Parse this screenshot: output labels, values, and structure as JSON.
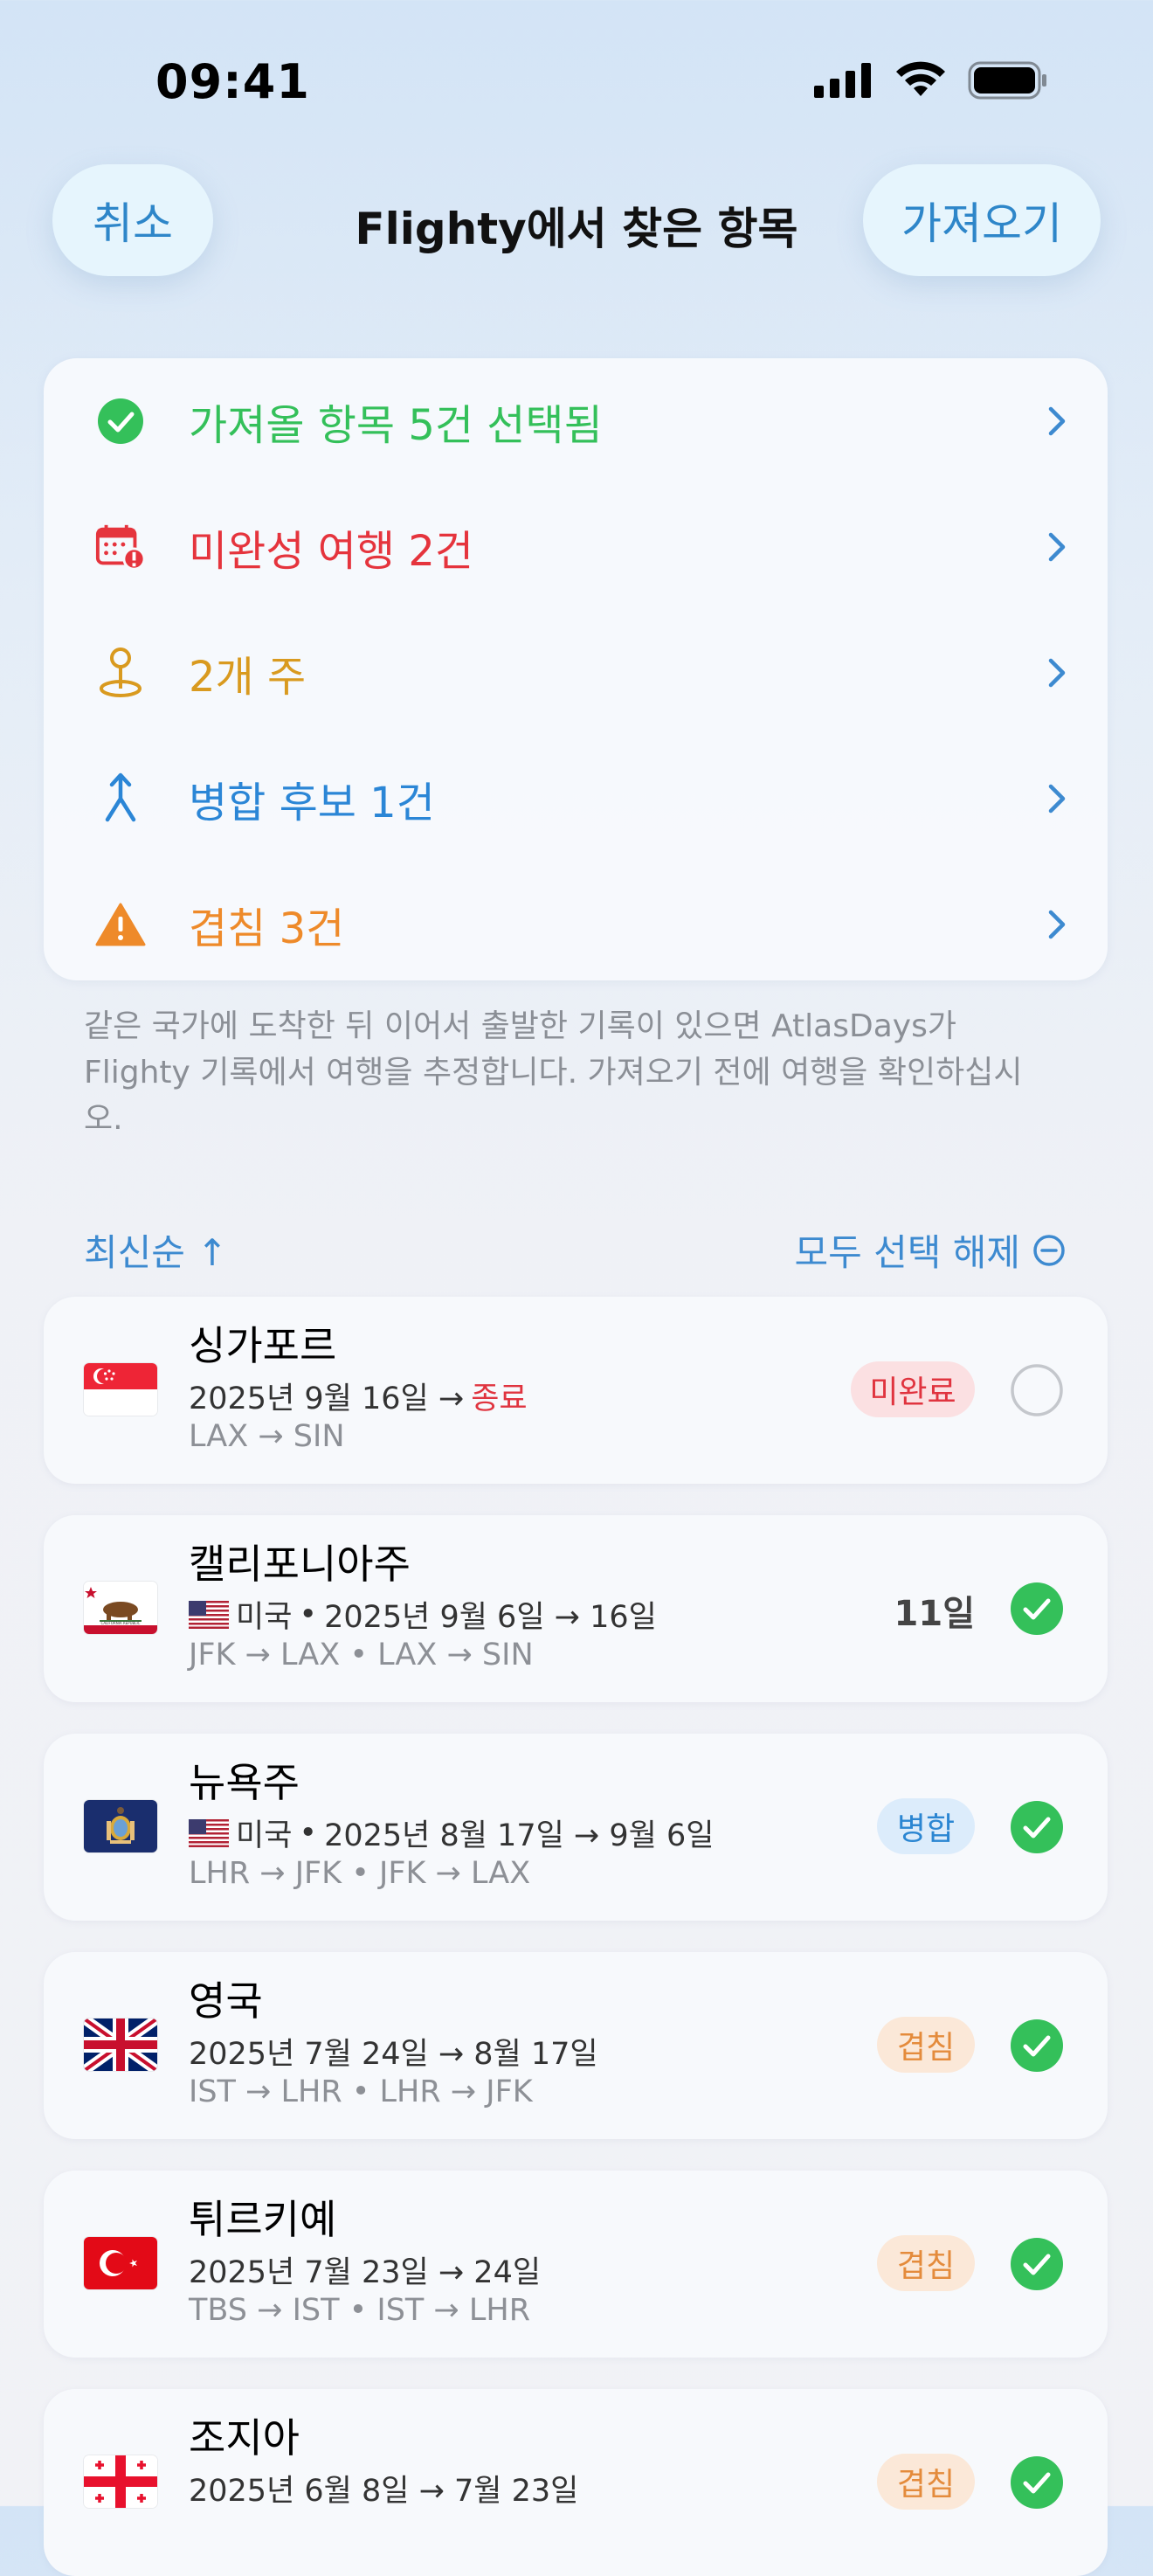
{
  "status_bar": {
    "time": "09:41"
  },
  "header": {
    "cancel": "취소",
    "title": "Flighty에서 찾은 항목",
    "import": "가져오기"
  },
  "summary": [
    {
      "label": "가져올 항목 5건 선택됨",
      "color": "#34c05a",
      "icon": "checkmark-circle-icon"
    },
    {
      "label": "미완성 여행 2건",
      "color": "#e5343d",
      "icon": "calendar-alert-icon"
    },
    {
      "label": "2개 주",
      "color": "#d99a1f",
      "icon": "location-pin-icon"
    },
    {
      "label": "병합 후보 1건",
      "color": "#2b86d6",
      "icon": "merge-arrow-icon"
    },
    {
      "label": "겹침 3건",
      "color": "#ee8a2a",
      "icon": "warning-triangle-icon"
    }
  ],
  "note": "같은 국가에 도착한 뒤 이어서 출발한 기록이 있으면 AtlasDays가 Flighty 기록에서 여행을 추정합니다. 가져오기 전에 여행을 확인하십시오.",
  "sort": {
    "label": "최신순 ↑",
    "deselect": "모두 선택 해제"
  },
  "trips": [
    {
      "title": "싱가포르",
      "date_prefix": "2025년 9월 16일 →",
      "date_end": "종료",
      "route": "LAX → SIN",
      "badge": "미완료",
      "selected": false
    },
    {
      "title": "캘리포니아주",
      "country": "미국",
      "date": "2025년 9월 6일 → 16일",
      "route": "JFK → LAX • LAX → SIN",
      "days": "11일",
      "selected": true
    },
    {
      "title": "뉴욕주",
      "country": "미국",
      "date": "2025년 8월 17일 → 9월 6일",
      "route": "LHR → JFK • JFK → LAX",
      "badge": "병합",
      "selected": true
    },
    {
      "title": "영국",
      "date": "2025년 7월 24일 → 8월 17일",
      "route": "IST → LHR • LHR → JFK",
      "badge": "겹침",
      "selected": true
    },
    {
      "title": "튀르키예",
      "date": "2025년 7월 23일 → 24일",
      "route": "TBS → IST • IST → LHR",
      "badge": "겹침",
      "selected": true
    },
    {
      "title": "조지아",
      "date": "2025년 6월 8일 → 7월 23일",
      "badge": "겹침",
      "selected": true
    }
  ]
}
